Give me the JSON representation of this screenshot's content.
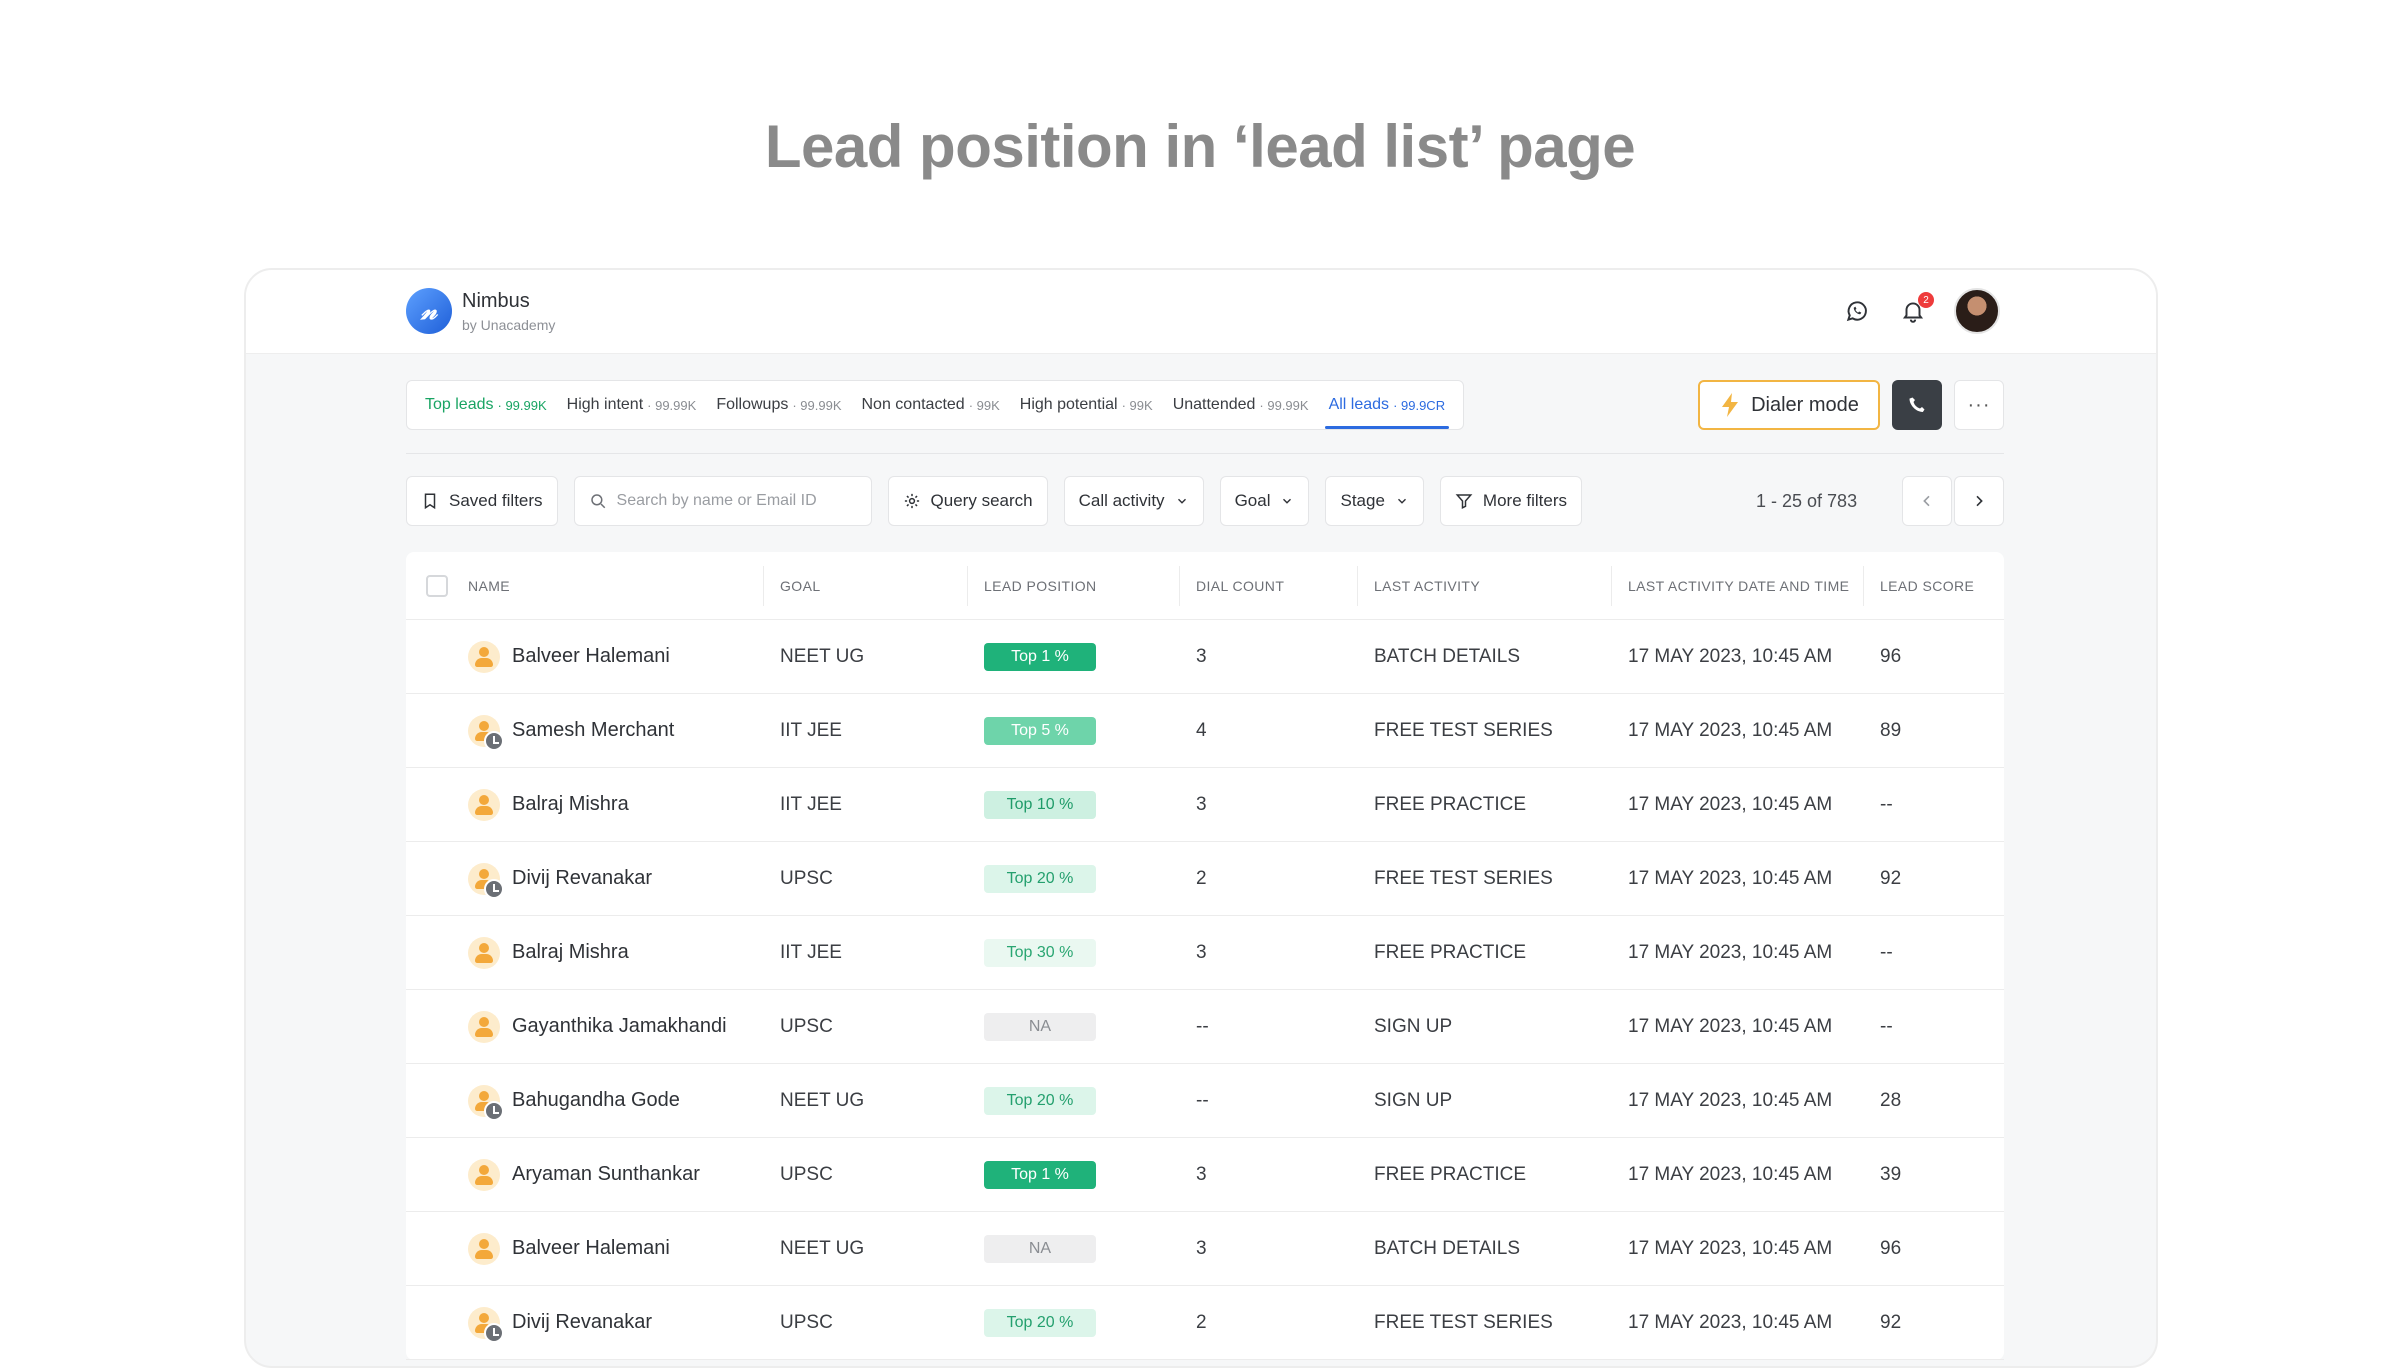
{
  "headline": "Lead position in ‘lead list’ page",
  "app": {
    "logo_glyph": "𝓃",
    "name": "Nimbus",
    "sub": "by Unacademy",
    "notification_count": "2"
  },
  "tabs": [
    {
      "label": "Top leads",
      "count": "· 99.99K",
      "style": "green"
    },
    {
      "label": "High intent",
      "count": "· 99.99K",
      "style": ""
    },
    {
      "label": "Followups",
      "count": "· 99.99K",
      "style": ""
    },
    {
      "label": "Non contacted",
      "count": "· 99K",
      "style": ""
    },
    {
      "label": "High potential",
      "count": "· 99K",
      "style": ""
    },
    {
      "label": "Unattended",
      "count": "· 99.99K",
      "style": ""
    },
    {
      "label": "All leads",
      "count": "· 99.9CR",
      "style": "blue active"
    }
  ],
  "actions": {
    "dialer_label": "Dialer mode",
    "more_label": "···"
  },
  "filters": {
    "saved": "Saved filters",
    "search_placeholder": "Search by name or Email ID",
    "query": "Query search",
    "call_activity": "Call activity",
    "goal": "Goal",
    "stage": "Stage",
    "more": "More filters"
  },
  "pager": {
    "text": "1 - 25 of 783"
  },
  "columns": [
    "NAME",
    "GOAL",
    "LEAD POSITION",
    "DIAL COUNT",
    "LAST ACTIVITY",
    "LAST ACTIVITY DATE AND TIME",
    "LEAD SCORE"
  ],
  "rows": [
    {
      "name": "Balveer Halemani",
      "goal": "NEET UG",
      "position": "Top 1 %",
      "pos_class": "p1",
      "dial": "3",
      "activity": "BATCH DETAILS",
      "datetime": "17 MAY 2023, 10:45 AM",
      "score": "96",
      "clock": false
    },
    {
      "name": "Samesh Merchant",
      "goal": "IIT JEE",
      "position": "Top 5 %",
      "pos_class": "p5",
      "dial": "4",
      "activity": "FREE TEST SERIES",
      "datetime": "17 MAY 2023, 10:45 AM",
      "score": "89",
      "clock": true
    },
    {
      "name": "Balraj Mishra",
      "goal": "IIT JEE",
      "position": "Top 10 %",
      "pos_class": "p10",
      "dial": "3",
      "activity": "FREE PRACTICE",
      "datetime": "17 MAY 2023, 10:45 AM",
      "score": "--",
      "clock": false
    },
    {
      "name": "Divij Revanakar",
      "goal": "UPSC",
      "position": "Top 20 %",
      "pos_class": "p20",
      "dial": "2",
      "activity": "FREE TEST SERIES",
      "datetime": "17 MAY 2023, 10:45 AM",
      "score": "92",
      "clock": true
    },
    {
      "name": "Balraj Mishra",
      "goal": "IIT JEE",
      "position": "Top 30 %",
      "pos_class": "p30",
      "dial": "3",
      "activity": "FREE PRACTICE",
      "datetime": "17 MAY 2023, 10:45 AM",
      "score": "--",
      "clock": false
    },
    {
      "name": "Gayanthika Jamakhandi",
      "goal": "UPSC",
      "position": "NA",
      "pos_class": "na",
      "dial": "--",
      "activity": "SIGN UP",
      "datetime": "17 MAY 2023, 10:45 AM",
      "score": "--",
      "clock": false
    },
    {
      "name": "Bahugandha Gode",
      "goal": "NEET UG",
      "position": "Top 20 %",
      "pos_class": "p20",
      "dial": "--",
      "activity": "SIGN UP",
      "datetime": "17 MAY 2023, 10:45 AM",
      "score": "28",
      "clock": true
    },
    {
      "name": "Aryaman Sunthankar",
      "goal": "UPSC",
      "position": "Top 1 %",
      "pos_class": "p1",
      "dial": "3",
      "activity": "FREE PRACTICE",
      "datetime": "17 MAY 2023, 10:45 AM",
      "score": "39",
      "clock": false
    },
    {
      "name": "Balveer Halemani",
      "goal": "NEET UG",
      "position": "NA",
      "pos_class": "na",
      "dial": "3",
      "activity": "BATCH DETAILS",
      "datetime": "17 MAY 2023, 10:45 AM",
      "score": "96",
      "clock": false
    },
    {
      "name": "Divij Revanakar",
      "goal": "UPSC",
      "position": "Top 20 %",
      "pos_class": "p20",
      "dial": "2",
      "activity": "FREE TEST SERIES",
      "datetime": "17 MAY 2023, 10:45 AM",
      "score": "92",
      "clock": true
    }
  ],
  "colors": {
    "accent_green": "#1fb27a",
    "accent_blue": "#2c6be0",
    "dialer_border": "#f2b543"
  }
}
